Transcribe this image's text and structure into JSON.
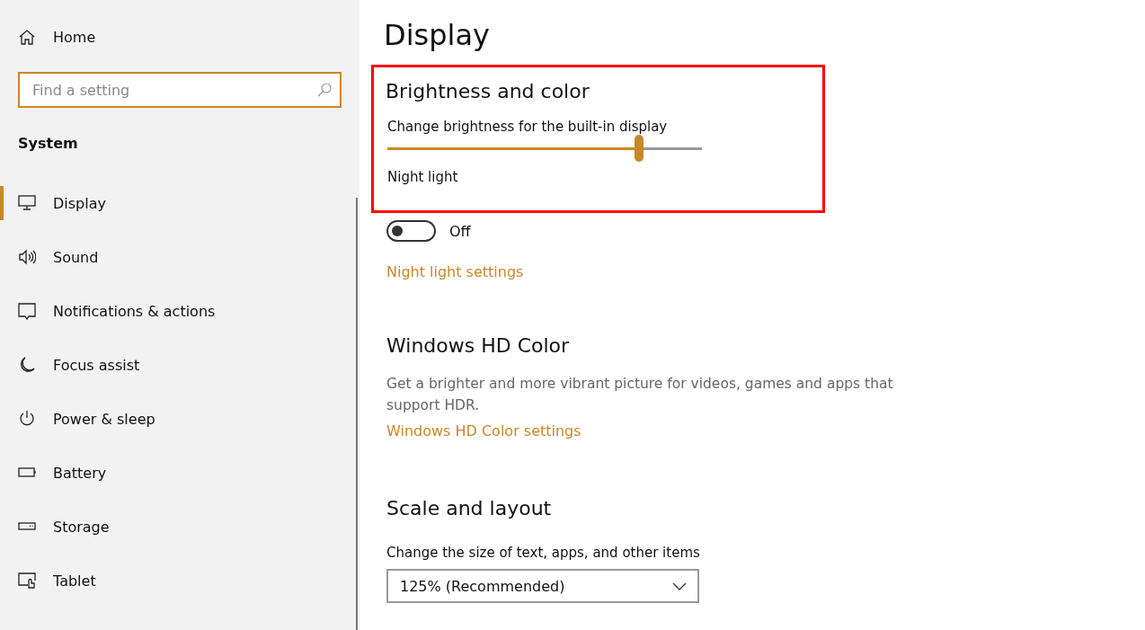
{
  "sidebar": {
    "home": "Home",
    "search": {
      "placeholder": "Find a setting"
    },
    "section": "System",
    "items": [
      {
        "label": "Display",
        "selected": true
      },
      {
        "label": "Sound",
        "selected": false
      },
      {
        "label": "Notifications & actions",
        "selected": false
      },
      {
        "label": "Focus assist",
        "selected": false
      },
      {
        "label": "Power & sleep",
        "selected": false
      },
      {
        "label": "Battery",
        "selected": false
      },
      {
        "label": "Storage",
        "selected": false
      },
      {
        "label": "Tablet",
        "selected": false
      }
    ]
  },
  "main": {
    "title": "Display",
    "brightness": {
      "heading": "Brightness and color",
      "highlighted": true,
      "label": "Change brightness for the built-in display",
      "level": 0.8,
      "night_light_label": "Night light"
    },
    "night_light": {
      "on": false,
      "state": "Off",
      "link": "Night light settings"
    },
    "hd_color": {
      "heading": "Windows HD Color",
      "description": "Get a brighter and more vibrant picture for videos, games and apps that support HDR.",
      "link": "Windows HD Color settings"
    },
    "scale": {
      "heading": "Scale and layout",
      "label": "Change the size of text, apps, and other items",
      "value": "125% (Recommended)"
    }
  }
}
